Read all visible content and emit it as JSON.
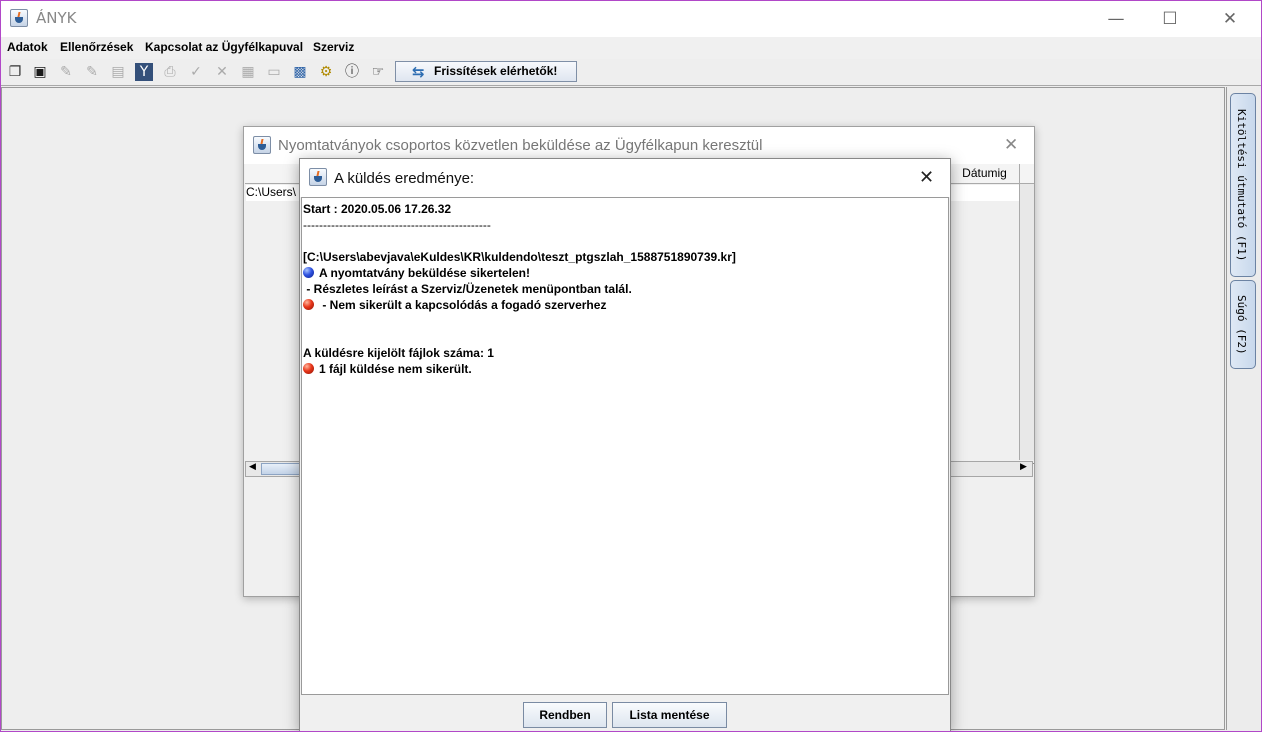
{
  "app": {
    "title": "ÁNYK",
    "window_controls": {
      "minimize": "—",
      "maximize": "☐",
      "close": "✕"
    }
  },
  "menu": {
    "items": [
      "Adatok",
      "Ellenőrzések",
      "Kapcsolat az Ügyfélkapuval",
      "Szerviz"
    ]
  },
  "toolbar": {
    "update_button": "Frissítések elérhetők!"
  },
  "side_panel": {
    "tabs": [
      "Kitöltési útmutató (F1)",
      "Súgó (F2)"
    ]
  },
  "bg_dialog": {
    "title": "Nyomtatványok csoportos közvetlen beküldése az Ügyfélkapun keresztül",
    "column_datumig": "Dátumig",
    "row_path_fragment": "C:\\Users\\"
  },
  "result_dialog": {
    "title": "A küldés eredménye:",
    "lines": {
      "start": "Start : 2020.05.06 17.26.32",
      "separator": "-----------------------------------------------",
      "file_path": "[C:\\Users\\abevjava\\eKuldes\\KR\\kuldendo\\teszt_ptgszlah_1588751890739.kr]",
      "status_failed": "A nyomtatvány beküldése sikertelen!",
      "details": " - Részletes leírást a Szerviz/Üzenetek menüpontban talál.",
      "connection_error": " - Nem sikerült a kapcsolódás a fogadó szerverhez",
      "file_count": "A küldésre kijelölt fájlok száma: 1",
      "send_failed": "1 fájl küldése nem sikerült."
    },
    "buttons": {
      "ok": "Rendben",
      "save_list": "Lista mentése"
    }
  }
}
